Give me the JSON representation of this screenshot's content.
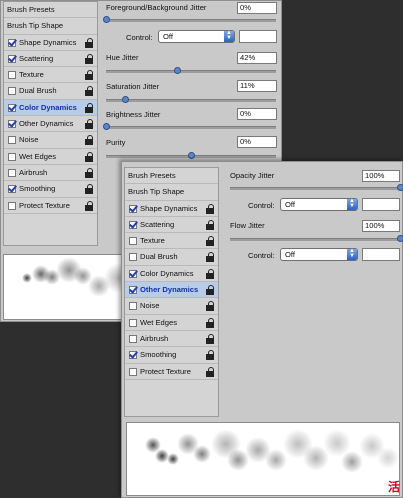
{
  "back_panel": {
    "list": {
      "header_presets": "Brush Presets",
      "header_tip": "Brush Tip Shape",
      "items": [
        {
          "label": "Shape Dynamics",
          "checked": true
        },
        {
          "label": "Scattering",
          "checked": true
        },
        {
          "label": "Texture",
          "checked": false
        },
        {
          "label": "Dual Brush",
          "checked": false
        },
        {
          "label": "Color Dynamics",
          "checked": true,
          "active": true
        },
        {
          "label": "Other Dynamics",
          "checked": true
        },
        {
          "label": "Noise",
          "checked": false
        },
        {
          "label": "Wet Edges",
          "checked": false
        },
        {
          "label": "Airbrush",
          "checked": false
        },
        {
          "label": "Smoothing",
          "checked": true
        },
        {
          "label": "Protect Texture",
          "checked": false
        }
      ]
    },
    "options": {
      "fg_bg_label": "Foreground/Background Jitter",
      "fg_bg_value": "0%",
      "fg_bg_level": 0,
      "control_label": "Control:",
      "control_value": "Off",
      "hue_label": "Hue Jitter",
      "hue_value": "42%",
      "hue_level": 0.42,
      "sat_label": "Saturation Jitter",
      "sat_value": "11%",
      "sat_level": 0.11,
      "bright_label": "Brightness Jitter",
      "bright_value": "0%",
      "bright_level": 0,
      "purity_label": "Purity",
      "purity_value": "0%",
      "purity_level": 0.5
    }
  },
  "front_panel": {
    "list": {
      "header_presets": "Brush Presets",
      "header_tip": "Brush Tip Shape",
      "items": [
        {
          "label": "Shape Dynamics",
          "checked": true
        },
        {
          "label": "Scattering",
          "checked": true
        },
        {
          "label": "Texture",
          "checked": false
        },
        {
          "label": "Dual Brush",
          "checked": false
        },
        {
          "label": "Color Dynamics",
          "checked": true
        },
        {
          "label": "Other Dynamics",
          "checked": true,
          "active": true
        },
        {
          "label": "Noise",
          "checked": false
        },
        {
          "label": "Wet Edges",
          "checked": false
        },
        {
          "label": "Airbrush",
          "checked": false
        },
        {
          "label": "Smoothing",
          "checked": true
        },
        {
          "label": "Protect Texture",
          "checked": false
        }
      ]
    },
    "options": {
      "opacity_label": "Opacity Jitter",
      "opacity_value": "100%",
      "opacity_level": 1,
      "control_label": "Control:",
      "control_value": "Off",
      "flow_label": "Flow Jitter",
      "flow_value": "100%",
      "flow_level": 1,
      "control2_label": "Control:",
      "control2_value": "Off"
    }
  },
  "watermark": "活"
}
